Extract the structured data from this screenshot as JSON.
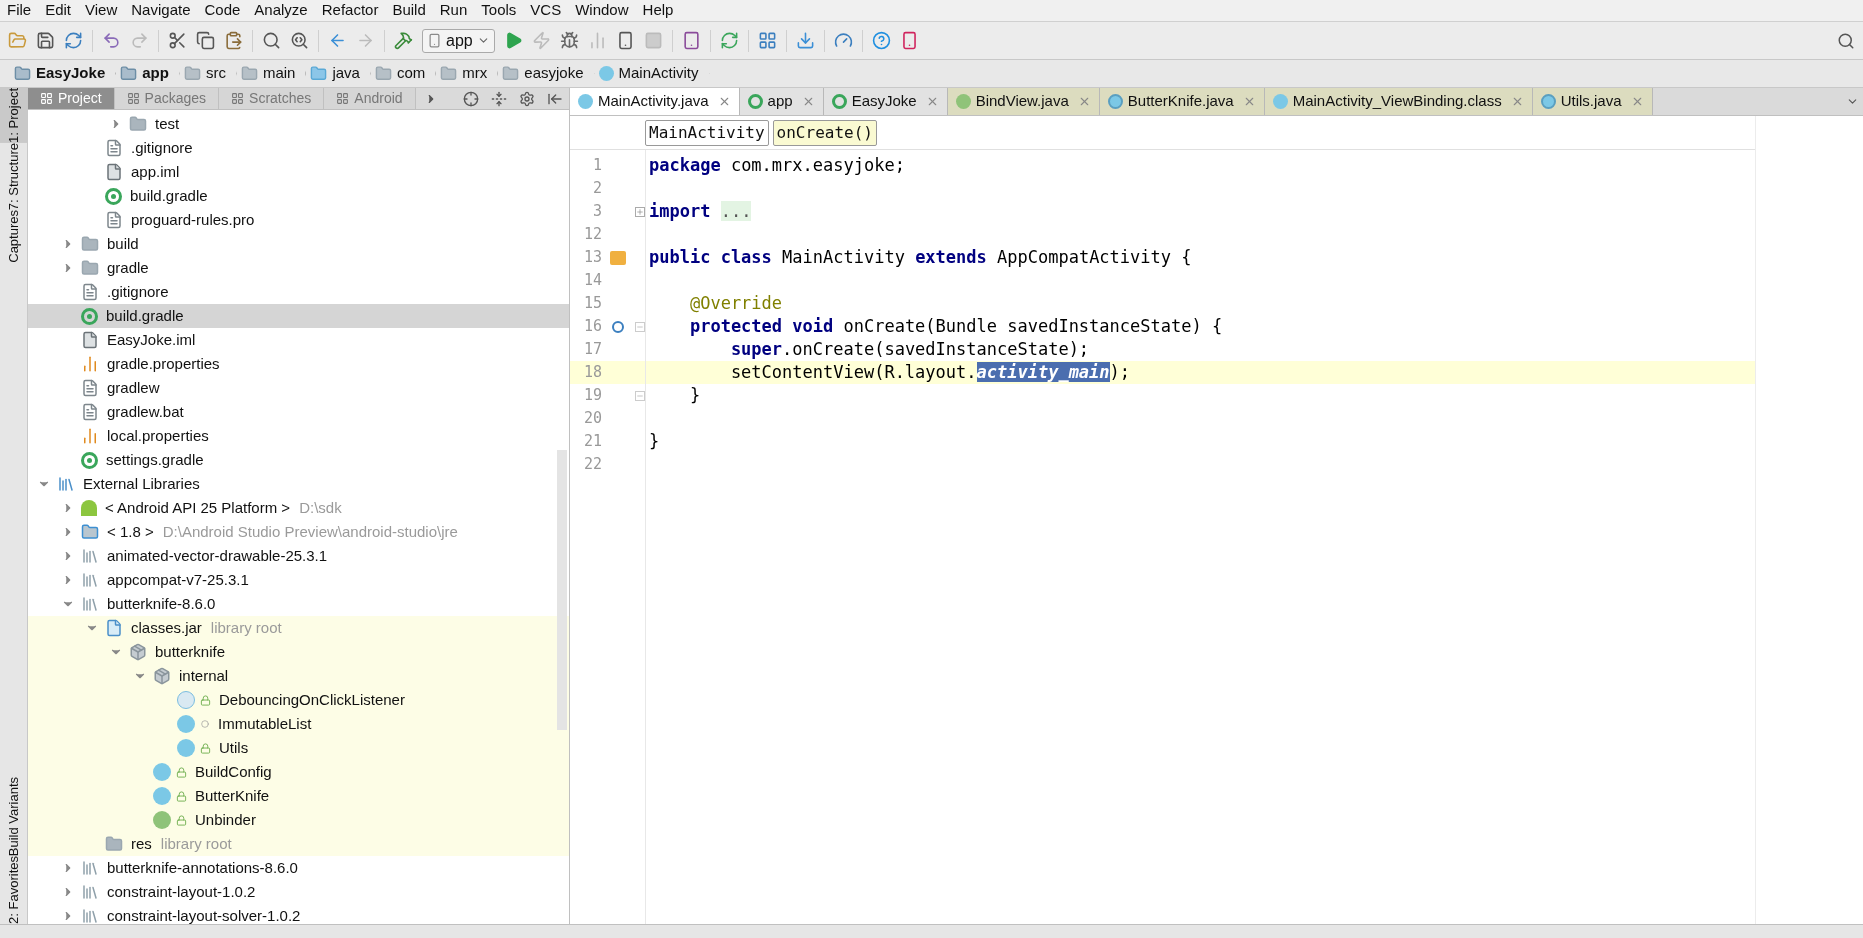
{
  "menu": [
    "File",
    "Edit",
    "View",
    "Navigate",
    "Code",
    "Analyze",
    "Refactor",
    "Build",
    "Run",
    "Tools",
    "VCS",
    "Window",
    "Help"
  ],
  "toolbar": {
    "run_config": "app"
  },
  "breadcrumb": [
    {
      "label": "EasyJoke",
      "kind": "module"
    },
    {
      "label": "app",
      "kind": "module"
    },
    {
      "label": "src",
      "kind": "folder"
    },
    {
      "label": "main",
      "kind": "folder"
    },
    {
      "label": "java",
      "kind": "source"
    },
    {
      "label": "com",
      "kind": "folder"
    },
    {
      "label": "mrx",
      "kind": "folder"
    },
    {
      "label": "easyjoke",
      "kind": "folder"
    },
    {
      "label": "MainActivity",
      "kind": "class"
    }
  ],
  "side_strip": [
    {
      "label": "1: Project",
      "selected": true
    },
    {
      "label": "7: Structure",
      "selected": false
    },
    {
      "label": "Captures",
      "selected": false
    },
    {
      "label": "Build Variants",
      "selected": false
    },
    {
      "label": "2: Favorites",
      "selected": false
    }
  ],
  "project_tabs": [
    {
      "label": "Project",
      "selected": true
    },
    {
      "label": "Packages",
      "selected": false
    },
    {
      "label": "Scratches",
      "selected": false
    },
    {
      "label": "Android",
      "selected": false
    }
  ],
  "editor_tabs": [
    {
      "label": "MainActivity.java",
      "kind": "class",
      "selected": true,
      "library": false
    },
    {
      "label": "app",
      "kind": "gradle",
      "selected": false,
      "library": false
    },
    {
      "label": "EasyJoke",
      "kind": "gradle",
      "selected": false,
      "library": false
    },
    {
      "label": "BindView.java",
      "kind": "annotation",
      "selected": false,
      "library": true
    },
    {
      "label": "ButterKnife.java",
      "kind": "locked-class",
      "selected": false,
      "library": true
    },
    {
      "label": "MainActivity_ViewBinding.class",
      "kind": "class",
      "selected": false,
      "library": true
    },
    {
      "label": "Utils.java",
      "kind": "locked-class",
      "selected": false,
      "library": true
    }
  ],
  "tree": [
    {
      "children": [
        {
          "children": [
            {
              "children": [
                {
                  "label": "test",
                  "kind": "folder",
                  "expanded": false,
                  "selected": false
                }
              ]
            },
            {
              "label": ".gitignore",
              "kind": "file",
              "selected": false
            },
            {
              "label": "app.iml",
              "kind": "iml",
              "selected": false
            },
            {
              "label": "build.gradle",
              "kind": "gradle",
              "selected": false
            },
            {
              "label": "proguard-rules.pro",
              "kind": "file",
              "selected": false
            }
          ]
        },
        {
          "label": "build",
          "kind": "folder",
          "expanded": false,
          "selected": false
        },
        {
          "label": "gradle",
          "kind": "folder",
          "expanded": false,
          "selected": false
        },
        {
          "label": ".gitignore",
          "kind": "file",
          "selected": false
        },
        {
          "label": "build.gradle",
          "kind": "gradle",
          "selected": true
        },
        {
          "label": "EasyJoke.iml",
          "kind": "iml",
          "selected": false
        },
        {
          "label": "gradle.properties",
          "kind": "properties",
          "selected": false
        },
        {
          "label": "gradlew",
          "kind": "file",
          "selected": false
        },
        {
          "label": "gradlew.bat",
          "kind": "file",
          "selected": false
        },
        {
          "label": "local.properties",
          "kind": "properties",
          "selected": false
        },
        {
          "label": "settings.gradle",
          "kind": "gradle",
          "selected": false
        }
      ]
    },
    {
      "label": "External Libraries",
      "kind": "libraries",
      "expanded": true,
      "selected": false,
      "children": [
        {
          "label": "< Android API 25 Platform >",
          "hint": "D:\\sdk",
          "kind": "android",
          "expanded": false,
          "selected": false
        },
        {
          "label": "< 1.8 >",
          "hint": "D:\\Android Studio Preview\\android-studio\\jre",
          "kind": "jdk",
          "expanded": false,
          "selected": false
        },
        {
          "label": "animated-vector-drawable-25.3.1",
          "kind": "library",
          "expanded": false,
          "selected": false
        },
        {
          "label": "appcompat-v7-25.3.1",
          "kind": "library",
          "expanded": false,
          "selected": false
        },
        {
          "label": "butterknife-8.6.0",
          "kind": "library",
          "expanded": true,
          "selected": false,
          "children": [
            {
              "label": "classes.jar",
              "hint": "library root",
              "kind": "jar",
              "library_root": true,
              "expanded": true,
              "selected": false,
              "children": [
                {
                  "label": "butterknife",
                  "kind": "package",
                  "expanded": true,
                  "selected": false,
                  "children": [
                    {
                      "label": "internal",
                      "kind": "package",
                      "expanded": true,
                      "selected": false,
                      "children": [
                        {
                          "label": "DebouncingOnClickListener",
                          "kind": "abstract-class",
                          "public": true,
                          "selected": false
                        },
                        {
                          "label": "ImmutableList",
                          "kind": "class",
                          "public": false,
                          "selected": false
                        },
                        {
                          "label": "Utils",
                          "kind": "class",
                          "public": true,
                          "selected": false
                        }
                      ]
                    },
                    {
                      "label": "BuildConfig",
                      "kind": "class",
                      "public": true,
                      "selected": false
                    },
                    {
                      "label": "ButterKnife",
                      "kind": "class",
                      "public": true,
                      "selected": false
                    },
                    {
                      "label": "Unbinder",
                      "kind": "interface",
                      "public": true,
                      "selected": false
                    }
                  ]
                }
              ]
            },
            {
              "label": "res",
              "hint": "library root",
              "kind": "folder",
              "library_root": true,
              "selected": false
            }
          ]
        },
        {
          "label": "butterknife-annotations-8.6.0",
          "kind": "library",
          "expanded": false,
          "selected": false
        },
        {
          "label": "constraint-layout-1.0.2",
          "kind": "library",
          "expanded": false,
          "selected": false
        },
        {
          "label": "constraint-layout-solver-1.0.2",
          "kind": "library",
          "expanded": false,
          "selected": false
        }
      ]
    }
  ],
  "method_breadcrumb": [
    {
      "label": "MainActivity",
      "selected": false
    },
    {
      "label": "onCreate()",
      "selected": true
    }
  ],
  "code": [
    {
      "number": "1",
      "current": false,
      "tokens": [
        {
          "kind": "keyword",
          "text": "package"
        },
        {
          "kind": "plain",
          "text": " com.mrx.easyjoke;"
        }
      ]
    },
    {
      "number": "2",
      "current": false
    },
    {
      "number": "3",
      "current": false,
      "kind": "collapsed",
      "tokens": [
        {
          "kind": "keyword",
          "text": "import"
        },
        {
          "kind": "folded",
          "text": "..."
        }
      ]
    },
    {
      "number": "12",
      "current": false
    },
    {
      "number": "13",
      "current": false,
      "kind": "implemented",
      "tokens": [
        {
          "kind": "keyword",
          "text": "public class"
        },
        {
          "kind": "plain",
          "text": " MainActivity "
        },
        {
          "kind": "keyword",
          "text": "extends"
        },
        {
          "kind": "plain",
          "text": " AppCompatActivity {"
        }
      ]
    },
    {
      "number": "14",
      "current": false
    },
    {
      "number": "15",
      "current": false,
      "tokens": [
        {
          "kind": "annotation",
          "text": "    @Override"
        }
      ]
    },
    {
      "number": "16",
      "current": false,
      "kind": "override-fold-start",
      "tokens": [
        {
          "kind": "keyword",
          "text": "    protected void"
        },
        {
          "kind": "plain",
          "text": " onCreate(Bundle savedInstanceState) {"
        }
      ]
    },
    {
      "number": "17",
      "current": false,
      "tokens": [
        {
          "kind": "keyword",
          "text": "        super"
        },
        {
          "kind": "plain",
          "text": ".onCreate(savedInstanceState);"
        }
      ]
    },
    {
      "number": "18",
      "current": true,
      "tokens": [
        {
          "kind": "plain",
          "text": "        setContentView(R.layout."
        },
        {
          "kind": "selection",
          "text": "activity_main"
        },
        {
          "kind": "plain",
          "text": ");"
        }
      ]
    },
    {
      "number": "19",
      "current": false,
      "kind": "fold-end",
      "tokens": [
        {
          "kind": "plain",
          "text": "    }"
        }
      ]
    },
    {
      "number": "20",
      "current": false
    },
    {
      "number": "21",
      "current": false,
      "tokens": [
        {
          "kind": "plain",
          "text": "}"
        }
      ]
    },
    {
      "number": "22",
      "current": false
    }
  ]
}
